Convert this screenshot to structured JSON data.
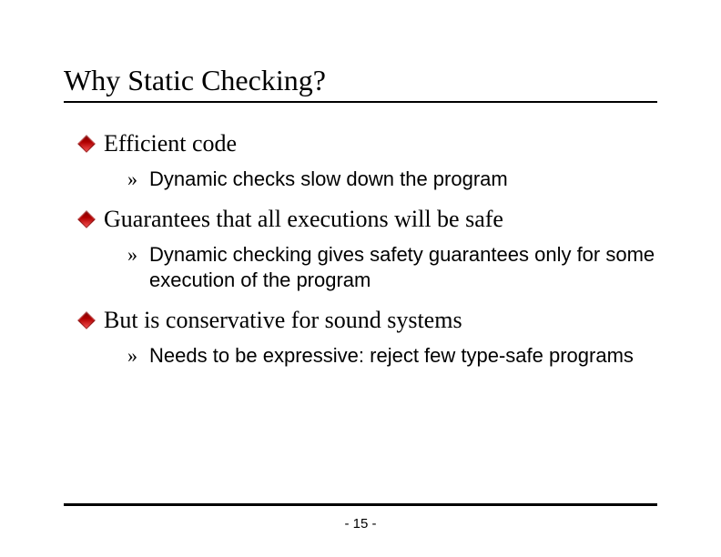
{
  "title": "Why Static Checking?",
  "bullets": [
    {
      "text": "Efficient code",
      "sub": [
        "Dynamic checks slow down the program"
      ]
    },
    {
      "text": "Guarantees that all executions will be safe",
      "sub": [
        "Dynamic checking gives safety guarantees only for some execution of the program"
      ]
    },
    {
      "text": "But is conservative for sound systems",
      "sub": [
        "Needs to be expressive: reject few type-safe programs"
      ]
    }
  ],
  "page_number": "- 15 -"
}
